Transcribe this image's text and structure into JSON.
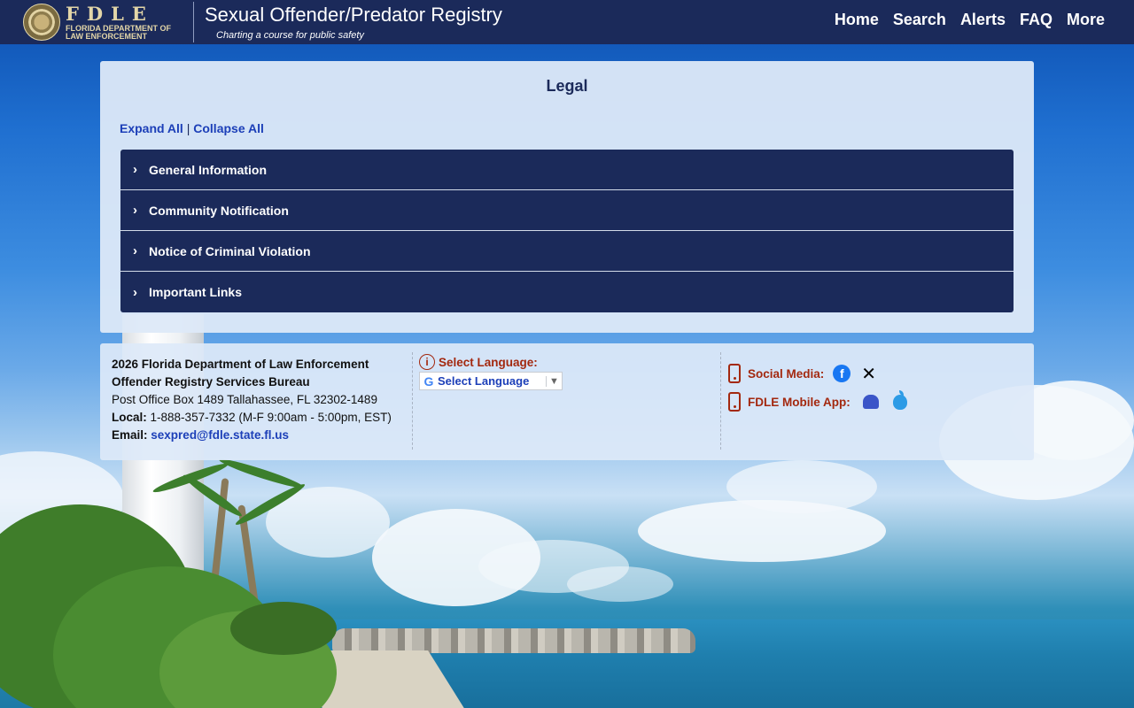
{
  "header": {
    "logo_letters": "FDLE",
    "logo_subtitle": "FLORIDA DEPARTMENT OF LAW ENFORCEMENT",
    "site_title": "Sexual Offender/Predator Registry",
    "tagline": "Charting a course for public safety",
    "nav": [
      "Home",
      "Search",
      "Alerts",
      "FAQ",
      "More"
    ]
  },
  "legal": {
    "title": "Legal",
    "expand_all": "Expand All",
    "separator": "|",
    "collapse_all": "Collapse All",
    "sections": [
      "General Information",
      "Community Notification",
      "Notice of Criminal Violation",
      "Important Links"
    ]
  },
  "footer": {
    "org_line": "2026 Florida Department of Law Enforcement",
    "bureau": "Offender Registry Services Bureau",
    "address": "Post Office Box 1489 Tallahassee, FL 32302-1489",
    "local_label": "Local:",
    "local_value": "1-888-357-7332 (M-F 9:00am - 5:00pm, EST)",
    "email_label": "Email:",
    "email_value": "sexpred@fdle.state.fl.us",
    "select_language_label": "Select Language:",
    "select_language_value": "Select Language",
    "social_media_label": "Social Media:",
    "mobile_app_label": "FDLE Mobile App:"
  },
  "icons": {
    "seal": "fdle-seal-icon",
    "chevron": "chevron-right-icon",
    "info": "info-icon",
    "google": "google-icon",
    "phone": "mobile-phone-icon",
    "facebook": "facebook-icon",
    "x": "x-twitter-icon",
    "android": "android-icon",
    "apple": "apple-icon"
  },
  "colors": {
    "header_bg": "#1b2a5a",
    "accordion_bg": "#1b2a5a",
    "link": "#1c3fb8",
    "accent_red": "#a3280f",
    "gold": "#e3d6a8"
  }
}
